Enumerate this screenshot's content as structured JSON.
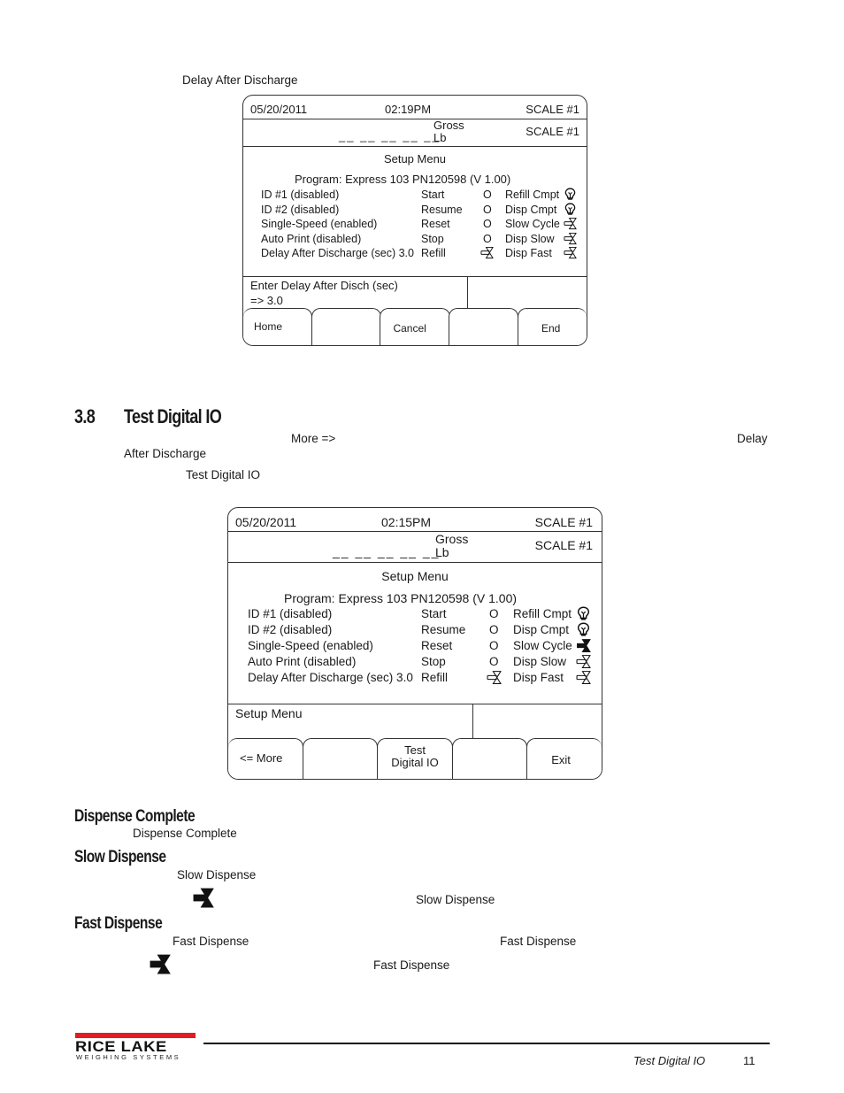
{
  "intro": {
    "term": "Delay After Discharge"
  },
  "screen1": {
    "date": "05/20/2011",
    "time": "02:19PM",
    "scale_top": "SCALE #1",
    "weight_dashes": "__ __ __ __ __",
    "mode": "Gross",
    "unit": "Lb",
    "scale_mid": "SCALE #1",
    "menu_title": "Setup Menu",
    "program": "Program: Express 103 PN120598  (V 1.00)",
    "settings": [
      "ID #1 (disabled)",
      "ID #2 (disabled)",
      "Single-Speed (enabled)",
      "Auto Print (disabled)",
      "Delay After Discharge (sec) 3.0"
    ],
    "inputs": [
      {
        "label": "Start",
        "state": "O"
      },
      {
        "label": "Resume",
        "state": "O"
      },
      {
        "label": "Reset",
        "state": "O"
      },
      {
        "label": "Stop",
        "state": "O"
      },
      {
        "label": "Refill",
        "state": "valve-outline-icon"
      }
    ],
    "outputs": [
      {
        "label": "Refill Cmpt",
        "icon": "lightbulb-outline-icon"
      },
      {
        "label": "Disp Cmpt",
        "icon": "lightbulb-outline-icon"
      },
      {
        "label": "Slow Cycle",
        "icon": "valve-outline-icon"
      },
      {
        "label": "Disp Slow",
        "icon": "valve-outline-icon"
      },
      {
        "label": "Disp Fast",
        "icon": "valve-outline-icon"
      }
    ],
    "prompt_line1": "Enter Delay After Disch (sec)",
    "prompt_line2": "=> 3.0",
    "softkeys": [
      "Home",
      "",
      "Cancel",
      "",
      "End"
    ]
  },
  "section": {
    "number": "3.8",
    "title": "Test Digital IO",
    "body_more": "More =>",
    "body_delay": "Delay",
    "body_after_discharge": "After Discharge",
    "body_test_digital_io": "Test  Digital  IO"
  },
  "screen2": {
    "date": "05/20/2011",
    "time": "02:15PM",
    "scale_top": "SCALE #1",
    "weight_dashes": "__ __ __ __ __",
    "mode": "Gross",
    "unit": "Lb",
    "scale_mid": "SCALE #1",
    "menu_title": "Setup Menu",
    "program": "Program: Express 103 PN120598  (V 1.00)",
    "settings": [
      "ID #1 (disabled)",
      "ID #2 (disabled)",
      "Single-Speed (enabled)",
      "Auto Print (disabled)",
      "Delay After Discharge (sec) 3.0"
    ],
    "inputs": [
      {
        "label": "Start",
        "state": "O"
      },
      {
        "label": "Resume",
        "state": "O"
      },
      {
        "label": "Reset",
        "state": "O"
      },
      {
        "label": "Stop",
        "state": "O"
      },
      {
        "label": "Refill",
        "state": "valve-outline-icon"
      }
    ],
    "outputs": [
      {
        "label": "Refill Cmpt",
        "icon": "lightbulb-outline-icon"
      },
      {
        "label": "Disp Cmpt",
        "icon": "lightbulb-outline-icon"
      },
      {
        "label": "Slow Cycle",
        "icon": "valve-filled-icon"
      },
      {
        "label": "Disp Slow",
        "icon": "valve-outline-icon"
      },
      {
        "label": "Disp Fast",
        "icon": "valve-outline-icon"
      }
    ],
    "prompt_line1": "Setup Menu",
    "softkeys": [
      "<= More",
      "",
      "Test\nDigital IO",
      "",
      "Exit"
    ]
  },
  "dispense_complete": {
    "heading": "Dispense Complete",
    "term": "Dispense Complete"
  },
  "slow_dispense": {
    "heading": "Slow Dispense",
    "term1": "Slow Dispense",
    "term2": "Slow Dispense"
  },
  "fast_dispense": {
    "heading": "Fast Dispense",
    "term1": "Fast Dispense",
    "term2": "Fast Dispense",
    "term3": "Fast Dispense"
  },
  "footer": {
    "logo_main": "RICE LAKE",
    "logo_sub": "WEIGHING SYSTEMS",
    "section_name": "Test Digital IO",
    "page_number": "11",
    "brand_red": "#e31b23"
  }
}
